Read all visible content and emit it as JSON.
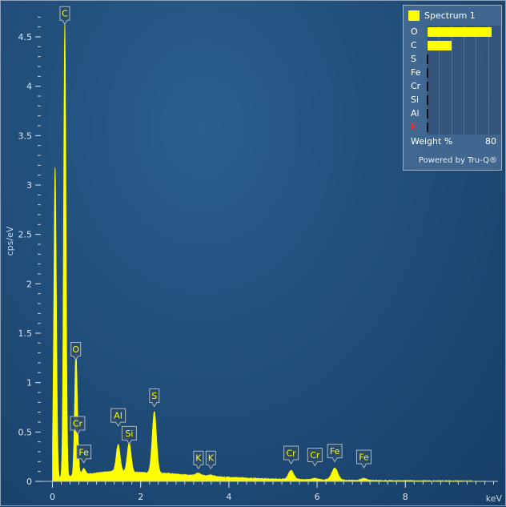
{
  "chart_data": {
    "type": "area",
    "xlabel": "keV",
    "ylabel": "cps/eV",
    "xlim": [
      -0.1,
      10.1
    ],
    "ylim": [
      0,
      4.8
    ],
    "x_ticks": [
      "0",
      "2",
      "4",
      "6",
      "8"
    ],
    "y_ticks": [
      "0",
      "0.5",
      "1",
      "1.5",
      "2",
      "2.5",
      "3",
      "3.5",
      "4",
      "4.5"
    ],
    "fill_color": "#ffff00",
    "background": "#22507d",
    "peaks": [
      {
        "x": 0.06,
        "height": 3.15,
        "width": 0.03
      },
      {
        "x": 0.28,
        "height": 4.6,
        "width": 0.028
      },
      {
        "x": 0.53,
        "height": 1.2,
        "width": 0.03
      },
      {
        "x": 0.57,
        "height": 0.2,
        "width": 0.03
      },
      {
        "x": 0.71,
        "height": 0.06,
        "width": 0.04
      },
      {
        "x": 1.49,
        "height": 0.28,
        "width": 0.045
      },
      {
        "x": 1.74,
        "height": 0.3,
        "width": 0.045
      },
      {
        "x": 2.31,
        "height": 0.62,
        "width": 0.05
      },
      {
        "x": 3.31,
        "height": 0.025,
        "width": 0.06
      },
      {
        "x": 3.59,
        "height": 0.015,
        "width": 0.06
      },
      {
        "x": 5.41,
        "height": 0.09,
        "width": 0.06
      },
      {
        "x": 5.95,
        "height": 0.015,
        "width": 0.06
      },
      {
        "x": 6.4,
        "height": 0.12,
        "width": 0.07
      },
      {
        "x": 7.06,
        "height": 0.02,
        "width": 0.07
      }
    ],
    "annotations": [
      {
        "text": "C",
        "x": 0.28,
        "y": 4.62
      },
      {
        "text": "O",
        "x": 0.53,
        "y": 1.22
      },
      {
        "text": "Cr",
        "x": 0.57,
        "y": 0.47
      },
      {
        "text": "Fe",
        "x": 0.71,
        "y": 0.18
      },
      {
        "text": "Al",
        "x": 1.49,
        "y": 0.55
      },
      {
        "text": "Si",
        "x": 1.74,
        "y": 0.37
      },
      {
        "text": "S",
        "x": 2.31,
        "y": 0.75
      },
      {
        "text": "K",
        "x": 3.31,
        "y": 0.12
      },
      {
        "text": "K",
        "x": 3.59,
        "y": 0.12
      },
      {
        "text": "Cr",
        "x": 5.41,
        "y": 0.17
      },
      {
        "text": "Cr",
        "x": 5.95,
        "y": 0.15
      },
      {
        "text": "Fe",
        "x": 6.4,
        "y": 0.19
      },
      {
        "text": "Fe",
        "x": 7.06,
        "y": 0.13
      }
    ]
  },
  "legend": {
    "title": "Spectrum 1",
    "swatch_color": "#ffff00",
    "elements": [
      {
        "label": "O",
        "weight_pct": 80,
        "color": "#ffffff"
      },
      {
        "label": "C",
        "weight_pct": 30,
        "color": "#ffffff"
      },
      {
        "label": "S",
        "weight_pct": 0,
        "color": "#ffffff"
      },
      {
        "label": "Fe",
        "weight_pct": 0,
        "color": "#ffffff"
      },
      {
        "label": "Cr",
        "weight_pct": 0,
        "color": "#ffffff"
      },
      {
        "label": "Si",
        "weight_pct": 0,
        "color": "#ffffff"
      },
      {
        "label": "Al",
        "weight_pct": 0,
        "color": "#ffffff"
      },
      {
        "label": "K",
        "weight_pct": 0,
        "color": "#ff2a2a"
      }
    ],
    "footer_label": "Weight %",
    "footer_max": "80",
    "powered_by": "Powered by Tru-Q®"
  }
}
